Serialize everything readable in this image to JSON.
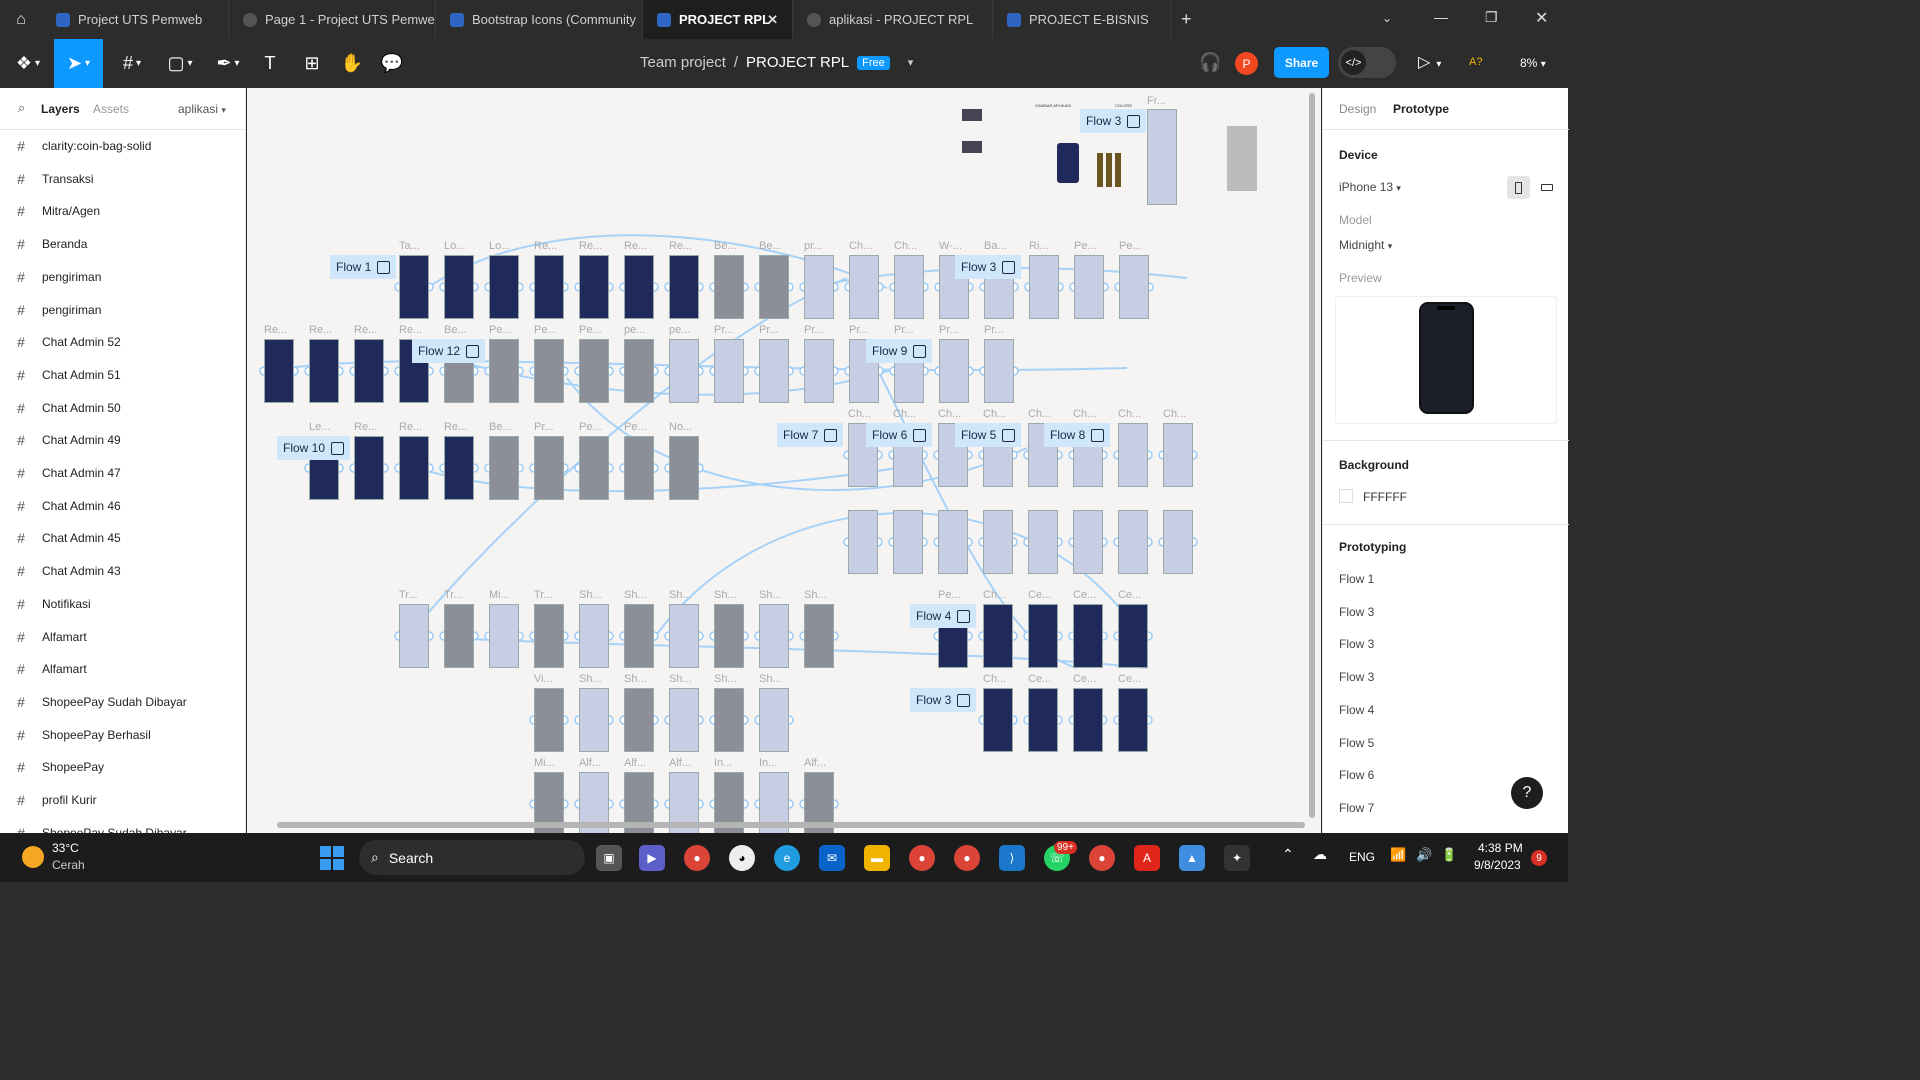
{
  "tabs": [
    {
      "label": "Project UTS Pemweb",
      "active": false,
      "kind": "figma"
    },
    {
      "label": "Page 1 - Project UTS Pemwe",
      "active": false,
      "kind": "play"
    },
    {
      "label": "Bootstrap Icons (Community",
      "active": false,
      "kind": "figma"
    },
    {
      "label": "PROJECT RPL",
      "active": true,
      "kind": "figma"
    },
    {
      "label": "aplikasi - PROJECT RPL",
      "active": false,
      "kind": "play"
    },
    {
      "label": "PROJECT E-BISNIS",
      "active": false,
      "kind": "figma"
    }
  ],
  "toolbar": {
    "breadcrumb_team": "Team project",
    "breadcrumb_sep": "/",
    "file_name": "PROJECT RPL",
    "plan_badge": "Free",
    "avatar_letter": "P",
    "share_label": "Share",
    "font_check": "A?",
    "zoom": "8%"
  },
  "left_panel": {
    "tab_layers": "Layers",
    "tab_assets": "Assets",
    "page_name": "aplikasi",
    "layers": [
      "clarity:coin-bag-solid",
      "Transaksi",
      "Mitra/Agen",
      "Beranda",
      "pengiriman",
      "pengiriman",
      "Chat Admin 52",
      "Chat Admin 51",
      "Chat Admin 50",
      "Chat Admin 49",
      "Chat Admin 47",
      "Chat Admin 46",
      "Chat Admin 45",
      "Chat Admin 43",
      "Notifikasi",
      "Alfamart",
      "Alfamart",
      "ShopeePay Sudah Dibayar",
      "ShopeePay Berhasil",
      "ShopeePay",
      "profil Kurir",
      "ShopeePay Sudah Dibayar"
    ]
  },
  "canvas": {
    "flows": [
      "Flow 3",
      "Flow 1",
      "Flow 3",
      "Flow 12",
      "Flow 9",
      "Flow 10",
      "Flow 7",
      "Flow 6",
      "Flow 5",
      "Flow 8",
      "Flow 4",
      "Flow 3"
    ],
    "row1_titles": [
      "Ta...",
      "Lo...",
      "Lo...",
      "Re...",
      "Re...",
      "Re...",
      "Re...",
      "Be...",
      "Be...",
      "pr...",
      "Ch...",
      "Ch...",
      "W-...",
      "Ba...",
      "Ri...",
      "Pe...",
      "Pe..."
    ],
    "row2_titles": [
      "Re...",
      "Re...",
      "Re...",
      "Re...",
      "Be...",
      "Pe...",
      "Pe...",
      "Pe...",
      "pe...",
      "pe...",
      "Pr...",
      "Pr...",
      "Pr...",
      "Pr...",
      "Pr...",
      "Pr...",
      "Pr..."
    ],
    "row3_titles": [
      "Le...",
      "Re...",
      "Re...",
      "Re...",
      "Be...",
      "Pr...",
      "Pe...",
      "Pe...",
      "No...",
      "Ch...",
      "Ch...",
      "Ch...",
      "Ch...",
      "Ch...",
      "Ch...",
      "Ch...",
      "Ch..."
    ],
    "row5_titles": [
      "Tr...",
      "Tr...",
      "Mi...",
      "Tr...",
      "Sh...",
      "Sh...",
      "Sh...",
      "Sh...",
      "Sh...",
      "Sh...",
      "Pe...",
      "Ch...",
      "Ce...",
      "Ce...",
      "Ce..."
    ],
    "row6_titles": [
      "Vi...",
      "Sh...",
      "Sh...",
      "Sh...",
      "Sh...",
      "Sh...",
      "Ch...",
      "Ce...",
      "Ce...",
      "Ce..."
    ],
    "row7_titles": [
      "Mi...",
      "Alf...",
      "Alf...",
      "Alf...",
      "In...",
      "In...",
      "Alf..."
    ],
    "mini_labels": {
      "gambar": "GAMBAR APLIKASI",
      "colors": "COLORS",
      "frame": "Fr..."
    }
  },
  "right_panel": {
    "tab_design": "Design",
    "tab_prototype": "Prototype",
    "device_heading": "Device",
    "device_value": "iPhone 13",
    "model_label": "Model",
    "model_value": "Midnight",
    "preview_label": "Preview",
    "background_heading": "Background",
    "background_hex": "FFFFFF",
    "prototyping_heading": "Prototyping",
    "flows": [
      "Flow 1",
      "Flow 3",
      "Flow 3",
      "Flow 3",
      "Flow 4",
      "Flow 5",
      "Flow 6",
      "Flow 7"
    ],
    "help": "?"
  },
  "taskbar": {
    "weather_temp": "33°C",
    "weather_desc": "Cerah",
    "search_label": "Search",
    "whatsapp_badge": "99+",
    "language": "ENG",
    "time": "4:38 PM",
    "date": "9/8/2023",
    "notification_count": "9"
  },
  "colors": {
    "accent": "#0d99ff",
    "frame_dark": "#1f2a5a",
    "flow_tag": "#cfe6fb",
    "avatar": "#f24822"
  }
}
